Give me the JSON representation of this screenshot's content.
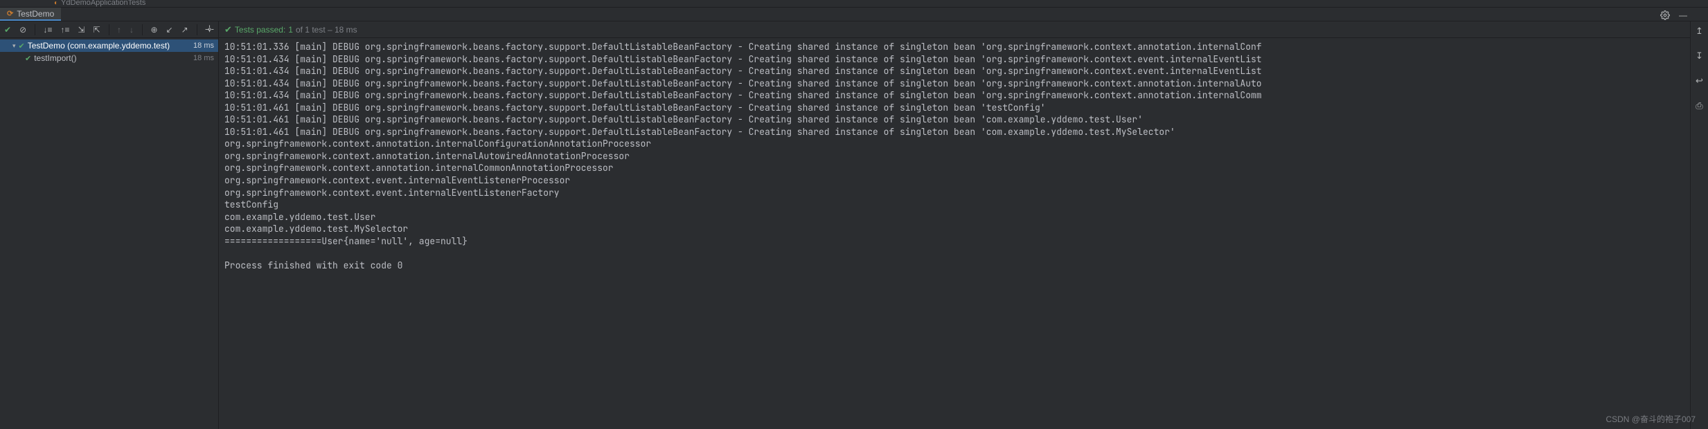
{
  "top_tab": {
    "label": "YdDemoApplicationTests"
  },
  "file_tab": {
    "label": "TestDemo"
  },
  "test_status": {
    "prefix": "Tests passed:",
    "count": "1",
    "rest": "of 1 test – 18 ms"
  },
  "tree": {
    "class_row": {
      "label": "TestDemo (com.example.yddemo.test)",
      "time": "18 ms"
    },
    "method_row": {
      "label": "testImport()",
      "time": "18 ms"
    }
  },
  "console_lines": [
    "10:51:01.336 [main] DEBUG org.springframework.beans.factory.support.DefaultListableBeanFactory - Creating shared instance of singleton bean 'org.springframework.context.annotation.internalConf",
    "10:51:01.434 [main] DEBUG org.springframework.beans.factory.support.DefaultListableBeanFactory - Creating shared instance of singleton bean 'org.springframework.context.event.internalEventList",
    "10:51:01.434 [main] DEBUG org.springframework.beans.factory.support.DefaultListableBeanFactory - Creating shared instance of singleton bean 'org.springframework.context.event.internalEventList",
    "10:51:01.434 [main] DEBUG org.springframework.beans.factory.support.DefaultListableBeanFactory - Creating shared instance of singleton bean 'org.springframework.context.annotation.internalAuto",
    "10:51:01.434 [main] DEBUG org.springframework.beans.factory.support.DefaultListableBeanFactory - Creating shared instance of singleton bean 'org.springframework.context.annotation.internalComm",
    "10:51:01.461 [main] DEBUG org.springframework.beans.factory.support.DefaultListableBeanFactory - Creating shared instance of singleton bean 'testConfig'",
    "10:51:01.461 [main] DEBUG org.springframework.beans.factory.support.DefaultListableBeanFactory - Creating shared instance of singleton bean 'com.example.yddemo.test.User'",
    "10:51:01.461 [main] DEBUG org.springframework.beans.factory.support.DefaultListableBeanFactory - Creating shared instance of singleton bean 'com.example.yddemo.test.MySelector'",
    "org.springframework.context.annotation.internalConfigurationAnnotationProcessor",
    "org.springframework.context.annotation.internalAutowiredAnnotationProcessor",
    "org.springframework.context.annotation.internalCommonAnnotationProcessor",
    "org.springframework.context.event.internalEventListenerProcessor",
    "org.springframework.context.event.internalEventListenerFactory",
    "testConfig",
    "com.example.yddemo.test.User",
    "com.example.yddemo.test.MySelector",
    "==================User{name='null', age=null}",
    "",
    "Process finished with exit code 0"
  ],
  "watermark": "CSDN @奋斗的袍子007"
}
